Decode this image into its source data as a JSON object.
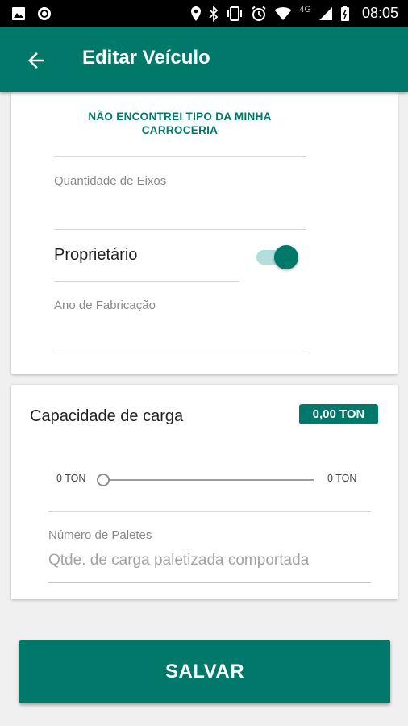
{
  "status_bar": {
    "time": "08:05",
    "network": "4G",
    "icons": [
      "image-icon",
      "record-icon",
      "location-icon",
      "bluetooth-icon",
      "vibrate-icon",
      "alarm-icon",
      "wifi-icon",
      "signal-icon",
      "battery-icon"
    ]
  },
  "header": {
    "title": "Editar Veículo",
    "back_icon": "arrow-left-icon"
  },
  "vehicle_card": {
    "body_type_link": "NÃO ENCONTREI TIPO DA MINHA CARROCERIA",
    "axles_label": "Quantidade de Eixos",
    "owner_label": "Proprietário",
    "owner_toggle_on": true,
    "year_label": "Ano de Fabricação"
  },
  "capacity_card": {
    "label": "Capacidade de carga",
    "badge": "0,00 TON",
    "slider_min": "0 TON",
    "slider_max": "0 TON",
    "slider_value": 0,
    "pallets_label": "Número de Paletes",
    "pallets_placeholder": "Qtde. de carga paletizada comportada"
  },
  "save_button": "SALVAR",
  "colors": {
    "primary": "#00796b",
    "primary_light": "#b2dfdb",
    "background": "#f0f0f0"
  }
}
